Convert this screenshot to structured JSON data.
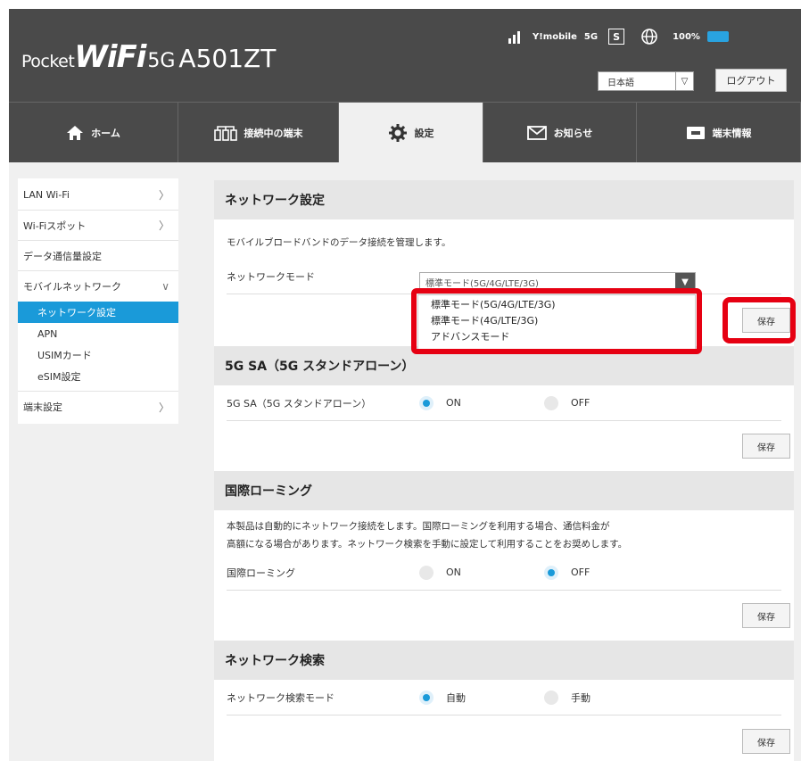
{
  "header": {
    "logo": {
      "pocket": "Pocket",
      "wifi": "WiFi",
      "fiveg": "5G",
      "model": "A501ZT"
    },
    "status": {
      "signal_icon": "signal-bars-icon",
      "carrier": "Y!mobile",
      "network": "5G",
      "sim": "S",
      "globe_icon": "globe-icon",
      "battery": "100%",
      "battery_color": "#29a3e0"
    },
    "language": "日本語",
    "logout": "ログアウト"
  },
  "nav": {
    "tabs": [
      {
        "label": "ホーム",
        "icon": "home-icon"
      },
      {
        "label": "接続中の端末",
        "icon": "devices-icon"
      },
      {
        "label": "設定",
        "icon": "gear-icon",
        "active": true
      },
      {
        "label": "お知らせ",
        "icon": "envelope-icon"
      },
      {
        "label": "端末情報",
        "icon": "device-info-icon"
      }
    ]
  },
  "sidebar": {
    "items": [
      {
        "label": "LAN Wi-Fi"
      },
      {
        "label": "Wi-Fiスポット"
      },
      {
        "label": "データ通信量設定"
      },
      {
        "label": "モバイルネットワーク"
      },
      {
        "label": "端末設定"
      }
    ],
    "subitems": [
      {
        "label": "ネットワーク設定",
        "active": true
      },
      {
        "label": "APN"
      },
      {
        "label": "USIMカード"
      },
      {
        "label": "eSIM設定"
      }
    ]
  },
  "network_settings": {
    "title": "ネットワーク設定",
    "description": "モバイルブロードバンドのデータ接続を管理します。",
    "mode_label": "ネットワークモード",
    "mode_value": "標準モード(5G/4G/LTE/3G)",
    "options": [
      "標準モード(5G/4G/LTE/3G)",
      "標準モード(4G/LTE/3G)",
      "アドバンスモード"
    ],
    "save": "保存"
  },
  "sa": {
    "title": "5G SA（5G スタンドアローン）",
    "label": "5G SA（5G スタンドアローン）",
    "on": "ON",
    "off": "OFF",
    "selected": "ON",
    "save": "保存"
  },
  "roaming": {
    "title": "国際ローミング",
    "description_1": "本製品は自動的にネットワーク接続をします。国際ローミングを利用する場合、通信料金が",
    "description_2": "高額になる場合があります。ネットワーク検索を手動に設定して利用することをお奨めします。",
    "label": "国際ローミング",
    "on": "ON",
    "off": "OFF",
    "selected": "OFF",
    "save": "保存"
  },
  "search": {
    "title": "ネットワーク検索",
    "label": "ネットワーク検索モード",
    "auto": "自動",
    "manual": "手動",
    "selected": "自動",
    "save": "保存"
  },
  "highlight_color": "#e60012",
  "accent_color": "#1a9ad9"
}
